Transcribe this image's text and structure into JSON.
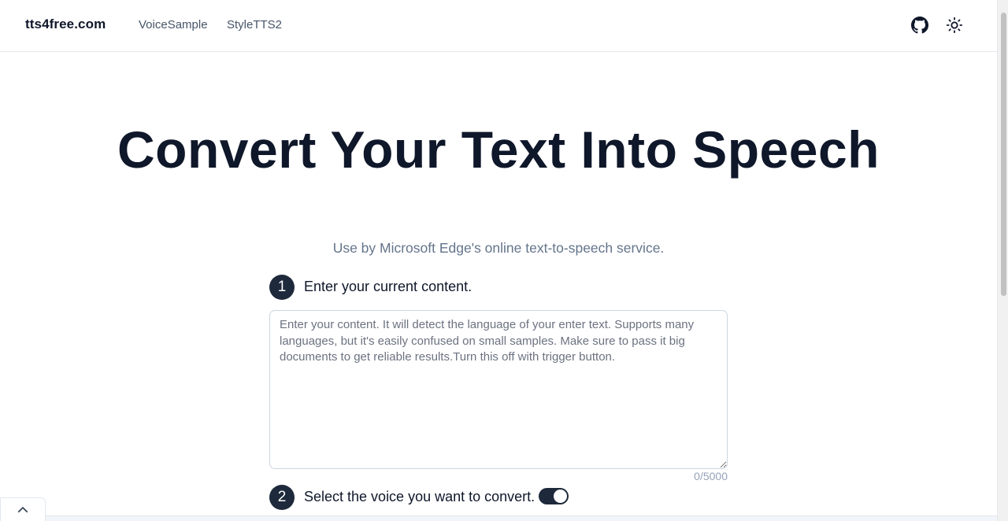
{
  "header": {
    "brand": "tts4free.com",
    "nav": [
      {
        "label": "VoiceSample"
      },
      {
        "label": "StyleTTS2"
      }
    ],
    "icons": {
      "github": "github-icon",
      "theme": "sun-icon"
    }
  },
  "hero": {
    "title": "Convert Your Text Into Speech",
    "subtitle": "Use by Microsoft Edge's online text-to-speech service."
  },
  "steps": [
    {
      "number": "1",
      "label": "Enter your current content."
    },
    {
      "number": "2",
      "label": "Select the voice you want to convert."
    }
  ],
  "content_input": {
    "value": "",
    "placeholder": "Enter your content. It will detect the language of your enter text. Supports many languages, but it's easily confused on small samples. Make sure to pass it big documents to get reliable results.Turn this off with trigger button.",
    "counter": "0/5000"
  },
  "voice_toggle": {
    "state": "on"
  },
  "back_to_top": {
    "icon": "chevron-up-icon"
  },
  "colors": {
    "dark": "#1e293b",
    "muted": "#64748b"
  }
}
